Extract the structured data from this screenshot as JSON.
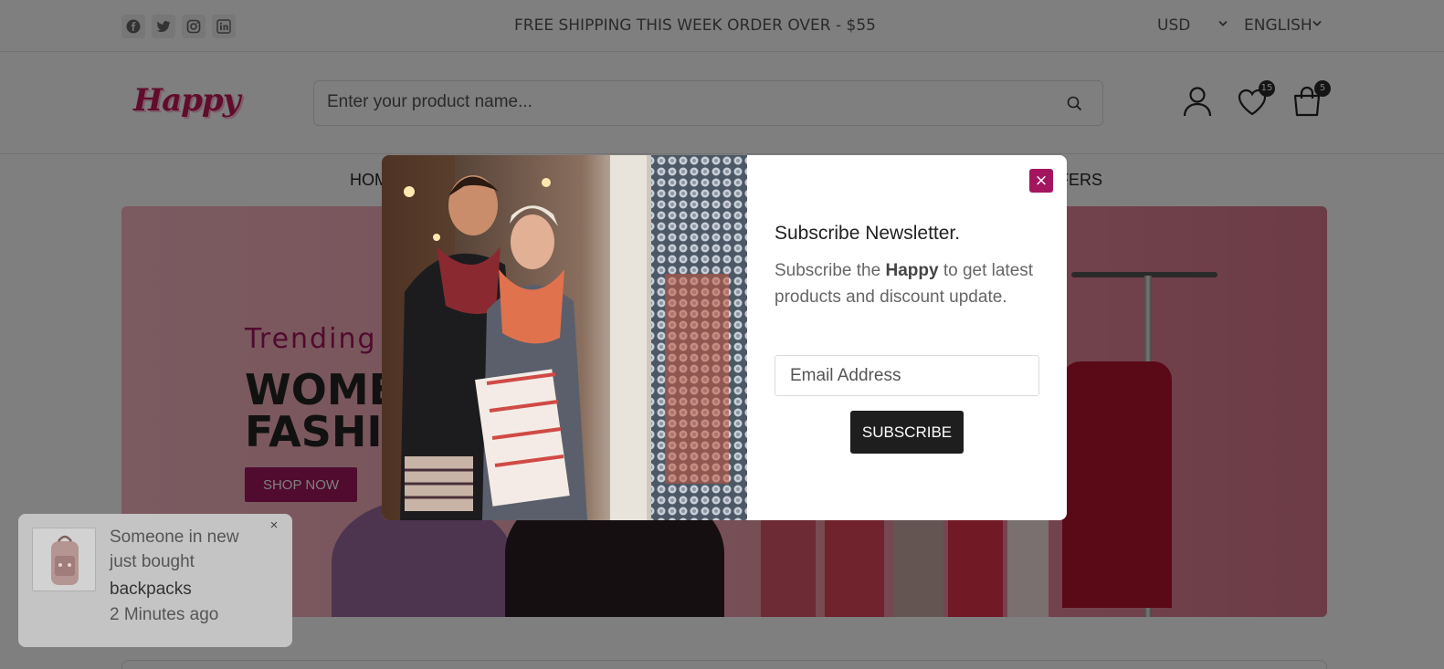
{
  "topbar": {
    "social": [
      "facebook-icon",
      "twitter-icon",
      "instagram-icon",
      "linkedin-icon"
    ],
    "promo": "FREE SHIPPING THIS WEEK ORDER OVER - $55",
    "currency": "USD",
    "language": "ENGLISH"
  },
  "header": {
    "logo": "Happy",
    "search_placeholder": "Enter your product name...",
    "wishlist_count": "15",
    "cart_count": "5"
  },
  "nav": {
    "first": "HOM",
    "last": "FERS"
  },
  "hero": {
    "subtitle": "Trending",
    "title_line1": "WOME",
    "title_line2": "FASHIO",
    "button": "SHOP NOW"
  },
  "modal": {
    "title": "Subscribe Newsletter.",
    "text_before": "Subscribe the ",
    "brand": "Happy",
    "text_after": " to get latest products and discount update.",
    "email_placeholder": "Email Address",
    "button": "SUBSCRIBE",
    "close": "×"
  },
  "toast": {
    "line1": "Someone in new just bought",
    "product": "backpacks",
    "time": "2 Minutes ago",
    "close": "×"
  },
  "colors": {
    "accent": "#a3165f",
    "hero_bg": "#f0a4b3",
    "dark_button": "#1e1e1e"
  }
}
